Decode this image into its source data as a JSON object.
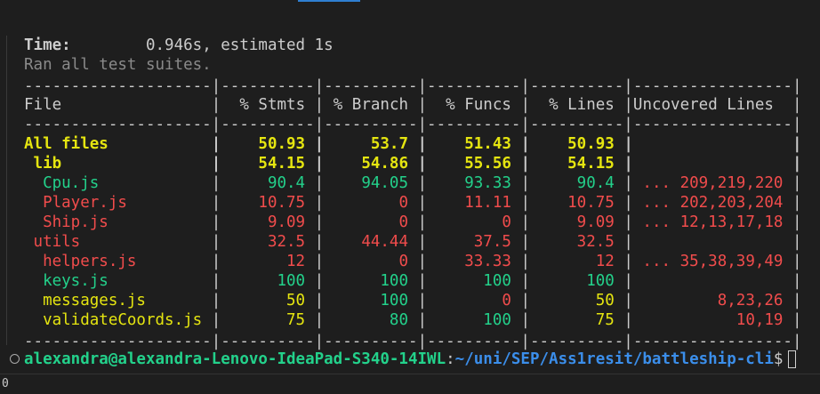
{
  "summary": {
    "time_label": "Time:",
    "time_value": "0.946s, estimated 1s",
    "ran_text": "Ran all test suites."
  },
  "table": {
    "separator": "--------------------|----------|----------|----------|----------|-----------------|",
    "headers": {
      "file": "File",
      "stmts": "% Stmts",
      "branch": "% Branch",
      "funcs": "% Funcs",
      "lines": "% Lines",
      "uncovered": "Uncovered Lines"
    },
    "rows": [
      {
        "file": "All files",
        "indent": 0,
        "stmts": "50.93",
        "branch": "53.7",
        "funcs": "51.43",
        "lines": "50.93",
        "uncovered": "",
        "colors": [
          "yellow",
          "yellow",
          "yellow",
          "yellow",
          "yellow",
          "plain"
        ],
        "bold": true
      },
      {
        "file": "lib",
        "indent": 1,
        "stmts": "54.15",
        "branch": "54.86",
        "funcs": "55.56",
        "lines": "54.15",
        "uncovered": "",
        "colors": [
          "yellow",
          "yellow",
          "yellow",
          "yellow",
          "yellow",
          "plain"
        ],
        "bold": true
      },
      {
        "file": "Cpu.js",
        "indent": 2,
        "stmts": "90.4",
        "branch": "94.05",
        "funcs": "93.33",
        "lines": "90.4",
        "uncovered": "... 209,219,220",
        "colors": [
          "green",
          "green",
          "green",
          "green",
          "green",
          "red"
        ],
        "bold": false
      },
      {
        "file": "Player.js",
        "indent": 2,
        "stmts": "10.75",
        "branch": "0",
        "funcs": "11.11",
        "lines": "10.75",
        "uncovered": "... 202,203,204",
        "colors": [
          "red",
          "red",
          "red",
          "red",
          "red",
          "red"
        ],
        "bold": false
      },
      {
        "file": "Ship.js",
        "indent": 2,
        "stmts": "9.09",
        "branch": "0",
        "funcs": "0",
        "lines": "9.09",
        "uncovered": "... 12,13,17,18",
        "colors": [
          "red",
          "red",
          "red",
          "red",
          "red",
          "red"
        ],
        "bold": false
      },
      {
        "file": "utils",
        "indent": 1,
        "stmts": "32.5",
        "branch": "44.44",
        "funcs": "37.5",
        "lines": "32.5",
        "uncovered": "",
        "colors": [
          "red",
          "red",
          "red",
          "red",
          "red",
          "plain"
        ],
        "bold": false
      },
      {
        "file": "helpers.js",
        "indent": 2,
        "stmts": "12",
        "branch": "0",
        "funcs": "33.33",
        "lines": "12",
        "uncovered": "... 35,38,39,49",
        "colors": [
          "red",
          "red",
          "red",
          "red",
          "red",
          "red"
        ],
        "bold": false
      },
      {
        "file": "keys.js",
        "indent": 2,
        "stmts": "100",
        "branch": "100",
        "funcs": "100",
        "lines": "100",
        "uncovered": "",
        "colors": [
          "green",
          "green",
          "green",
          "green",
          "green",
          "plain"
        ],
        "bold": false
      },
      {
        "file": "messages.js",
        "indent": 2,
        "stmts": "50",
        "branch": "100",
        "funcs": "0",
        "lines": "50",
        "uncovered": "8,23,26",
        "colors": [
          "yellow",
          "yellow",
          "green",
          "red",
          "yellow",
          "red"
        ],
        "bold": false
      },
      {
        "file": "validateCoords.js",
        "indent": 2,
        "stmts": "75",
        "branch": "80",
        "funcs": "100",
        "lines": "75",
        "uncovered": "10,19",
        "colors": [
          "yellow",
          "yellow",
          "green",
          "green",
          "yellow",
          "red"
        ],
        "bold": false
      }
    ]
  },
  "prompt": {
    "user_host": "alexandra@alexandra-Lenovo-IdeaPad-S340-14IWL",
    "colon": ":",
    "path": "~/uni/SEP/Ass1resit/battleship-cli",
    "symbol": "$"
  },
  "status_bar": {
    "value": "0"
  },
  "colors": {
    "background": "#1e1e1e",
    "yellow": "#e5e510",
    "green": "#23d18b",
    "red": "#f14c4c",
    "blue": "#3b8eea"
  }
}
